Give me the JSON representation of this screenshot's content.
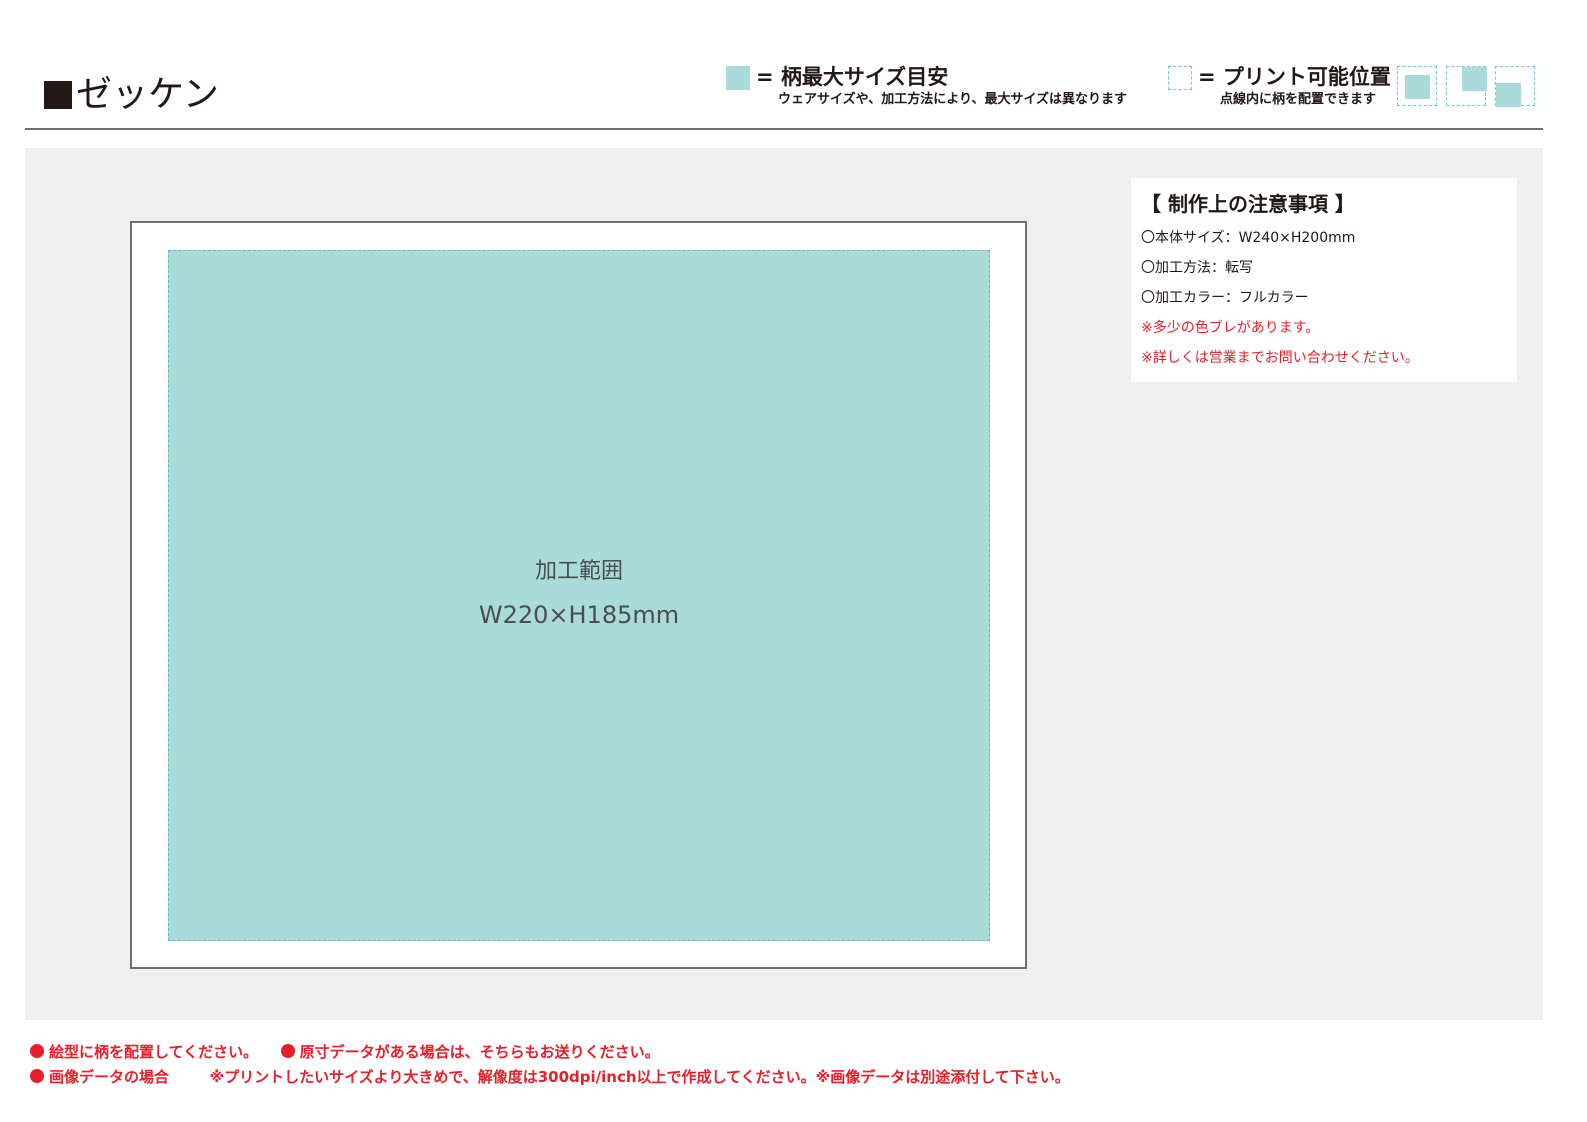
{
  "header": {
    "title": "ゼッケン",
    "legend_max_size": {
      "label": "= 柄最大サイズ目安",
      "note": "ウェアサイズや、加工方法により、最大サイズは異なります"
    },
    "legend_print_position": {
      "label": "= プリント可能位置",
      "note": "点線内に柄を配置できます"
    }
  },
  "diagram": {
    "area_label": "加工範囲",
    "area_size": "W220×H185mm"
  },
  "notes": {
    "heading": "【 制作上の注意事項 】",
    "lines": [
      "〇本体サイズ：W240×H200mm",
      "〇加工方法：転写",
      "〇加工カラー：フルカラー",
      "※多少の色ブレがあります。",
      "※詳しくは営業までお問い合わせください。"
    ]
  },
  "footer": {
    "row1_item1": "絵型に柄を配置してください。",
    "row1_item2": "原寸データがある場合は、そちらもお送りください。",
    "row2_label": "画像データの場合",
    "row2_text": "※プリントしたいサイズより大きめで、解像度は300dpi/inch以上で作成してください。※画像データは別途添付して下さい。"
  },
  "colors": {
    "print_area": "#a9dbd9",
    "dashed_border": "#6ec6d0",
    "warning_red": "#e6202a",
    "panel_bg": "#eeefee",
    "text_dark": "#231815"
  }
}
